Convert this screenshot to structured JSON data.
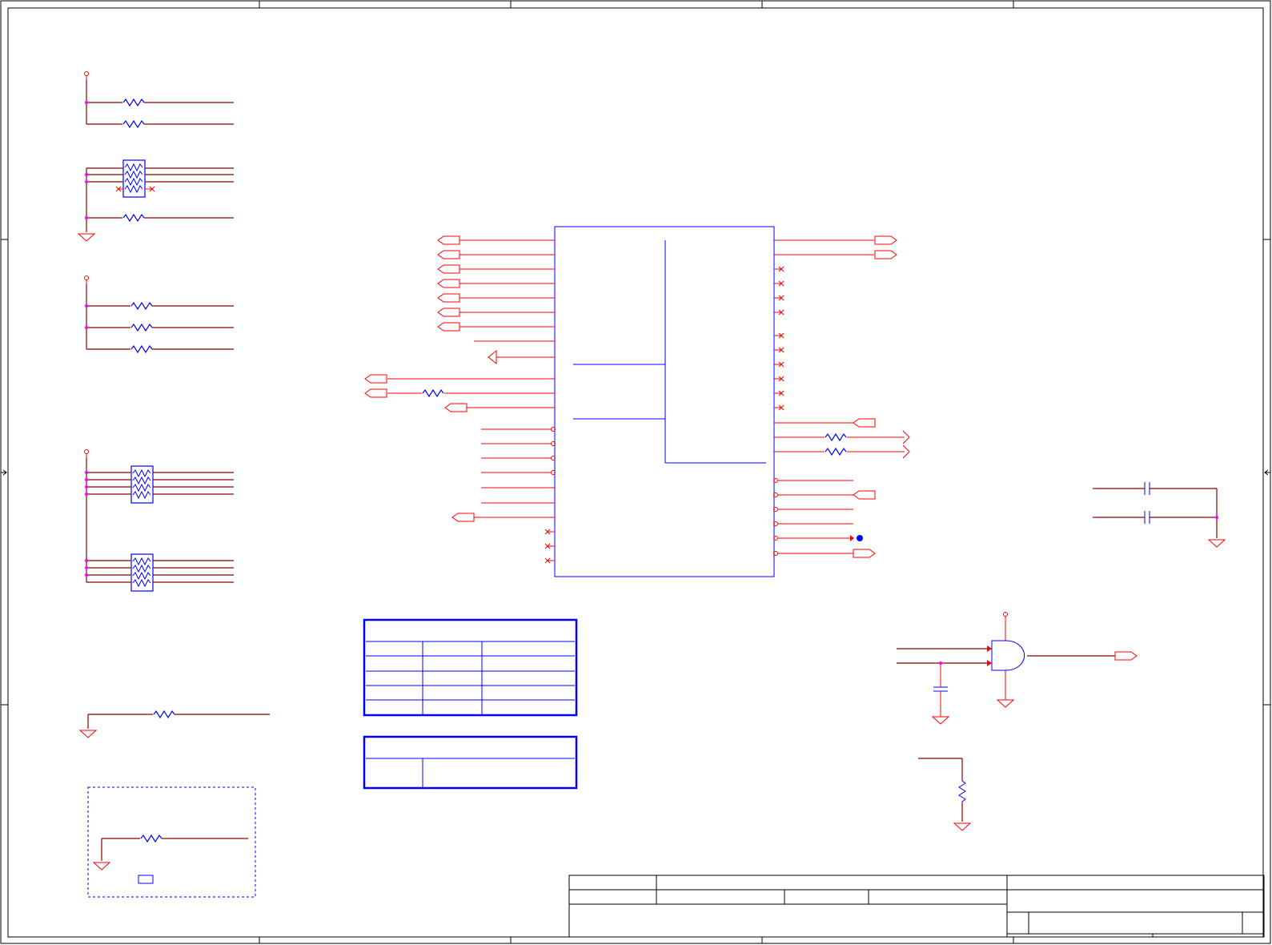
{
  "sheet": {
    "background": "#ffffff",
    "colors": {
      "net_wire": "#8b0000",
      "pin_wire": "#ff0000",
      "component": "#0000ff",
      "junction": "#ff00ff",
      "frame": "#000000"
    },
    "zones_left_marker": "arrow-left-icon",
    "zones_right_marker": "arrow-right-icon"
  },
  "components": {
    "main_ic": "ic-block",
    "resistor_symbol": "resistor-icon",
    "resistor_network_symbol": "resistor-network-icon",
    "capacitor_symbol": "capacitor-icon",
    "and_gate_symbol": "and-gate-icon",
    "ground_symbol": "ground-icon",
    "power_symbol": "power-pin-icon",
    "offpage_connector": "offpage-connector-icon",
    "no_connect": "no-connect-icon"
  },
  "tables": {
    "strap_table": {
      "rows": 5,
      "columns": 3
    },
    "note_table": {
      "rows": 2,
      "columns": 2
    }
  },
  "title_block": {}
}
